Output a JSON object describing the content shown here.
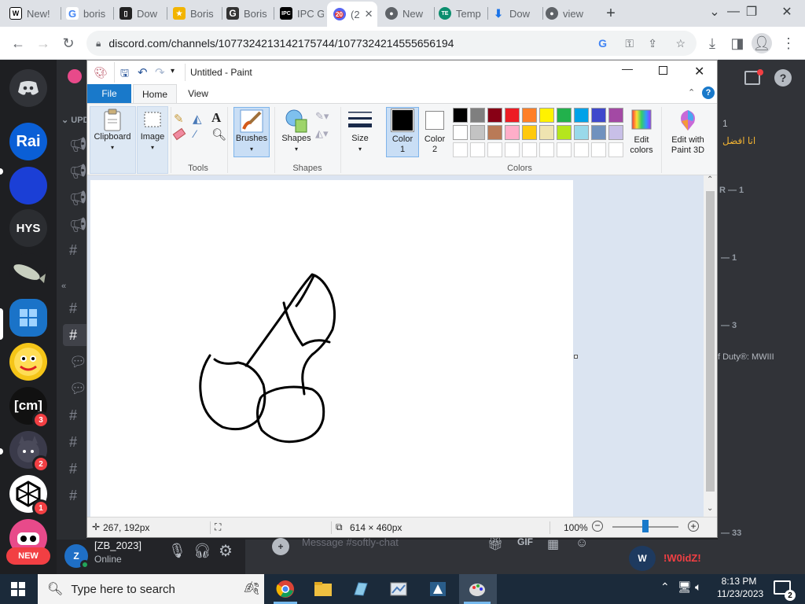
{
  "browser": {
    "tabs": [
      {
        "label": "New!",
        "icon": "wikipedia-icon"
      },
      {
        "label": "boris",
        "icon": "google-icon"
      },
      {
        "label": "Dow",
        "icon": "document-icon"
      },
      {
        "label": "Boris",
        "icon": "bookmark-icon"
      },
      {
        "label": "Boris",
        "icon": "google-icon"
      },
      {
        "label": "IPC G",
        "icon": "ipc-icon"
      },
      {
        "label": "(2",
        "icon": "discord-icon",
        "badge": "20"
      },
      {
        "label": "New",
        "icon": "chrome-icon"
      },
      {
        "label": "Temp",
        "icon": "temp-icon"
      },
      {
        "label": "Dow",
        "icon": "download-icon"
      },
      {
        "label": "view",
        "icon": "chrome-icon"
      }
    ],
    "url": "discord.com/channels/1077324213142175744/1077324214555656194"
  },
  "discord": {
    "servers": [
      {
        "label": "Rai",
        "color": "#0a5fd6"
      },
      {
        "label": "",
        "color": "#1b3fd6"
      },
      {
        "label": "HYS",
        "color": "#2b2d31"
      },
      {
        "label": "",
        "color": "#1e1f22"
      },
      {
        "label": "",
        "color": "#1a73c8"
      },
      {
        "label": "",
        "color": "#f5c518"
      },
      {
        "label": "[cm]",
        "color": "#111111",
        "badge": "3"
      },
      {
        "label": "",
        "color": "#3a3a4a",
        "badge": "2"
      },
      {
        "label": "",
        "color": "#ffffff",
        "badge": "1"
      },
      {
        "label": "",
        "color": "#e84a8a"
      }
    ],
    "new_label": "NEW",
    "channel_header": "UPD",
    "user": {
      "name": "[ZB_2023]",
      "status": "Online"
    },
    "chat_placeholder": "Message #softly-chat",
    "right": {
      "line1": "1",
      "arabic": "انا افضل",
      "r1": "R — 1",
      "r2": "— 1",
      "r3": "— 3",
      "cod": "f Duty®: MWIII",
      "r4": "— 33",
      "username": "!W0idZ!"
    }
  },
  "paint": {
    "title": "Untitled - Paint",
    "menu": {
      "file": "File",
      "home": "Home",
      "view": "View"
    },
    "ribbon": {
      "clipboard": "Clipboard",
      "image": "Image",
      "tools": "Tools",
      "brushes": "Brushes",
      "shapes": "Shapes",
      "shapes_group": "Shapes",
      "size": "Size",
      "color1": [
        "Color",
        "1"
      ],
      "color2": [
        "Color",
        "2"
      ],
      "colors_group": "Colors",
      "edit_colors": [
        "Edit",
        "colors"
      ],
      "edit_paint3d": [
        "Edit with",
        "Paint 3D"
      ]
    },
    "palette_row1": [
      "#000000",
      "#7f7f7f",
      "#880015",
      "#ed1c24",
      "#ff7f27",
      "#fff200",
      "#22b14c",
      "#00a2e8",
      "#3f48cc",
      "#a349a4"
    ],
    "palette_row2": [
      "#ffffff",
      "#c3c3c3",
      "#b97a57",
      "#ffaec9",
      "#ffc90e",
      "#efe4b0",
      "#b5e61d",
      "#99d9ea",
      "#7092be",
      "#c8bfe7"
    ],
    "color1_value": "#000000",
    "color2_value": "#ffffff",
    "status": {
      "cursor": "267, 192px",
      "size": "614 × 460px",
      "zoom": "100%"
    }
  },
  "taskbar": {
    "search_placeholder": "Type here to search",
    "time": "8:13 PM",
    "date": "11/23/2023",
    "notifications": "2"
  }
}
